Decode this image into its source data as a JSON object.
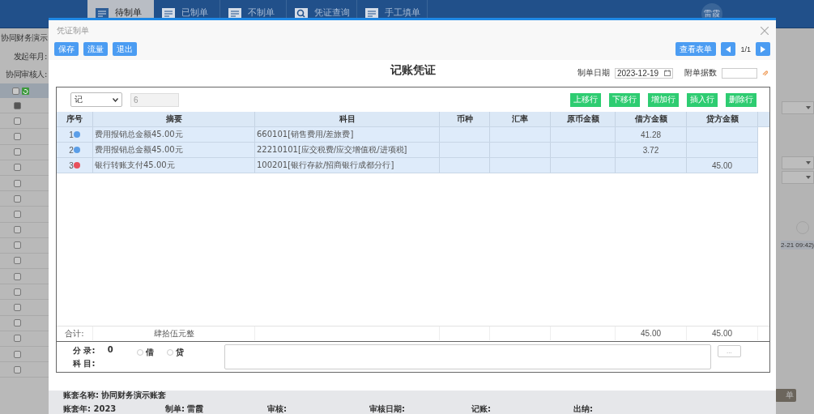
{
  "nav": {
    "tabs": [
      {
        "label": "待制单",
        "selected": true
      },
      {
        "label": "已制单",
        "selected": false
      },
      {
        "label": "不制单",
        "selected": false
      },
      {
        "label": "凭证查询",
        "selected": false
      },
      {
        "label": "手工填单",
        "selected": false
      }
    ],
    "user": "雷霞"
  },
  "left_panel": {
    "account": "协同财务演示",
    "fields": [
      "发起年月:",
      "协同审核人:"
    ],
    "header_checked": false,
    "rows": [
      {
        "checked": true
      },
      {
        "checked": false
      },
      {
        "checked": false
      },
      {
        "checked": false
      },
      {
        "checked": false
      },
      {
        "checked": false
      },
      {
        "checked": false
      },
      {
        "checked": false
      },
      {
        "checked": false
      },
      {
        "checked": false
      },
      {
        "checked": false
      },
      {
        "checked": false
      },
      {
        "checked": false
      },
      {
        "checked": false
      },
      {
        "checked": false
      },
      {
        "checked": false
      },
      {
        "checked": false
      },
      {
        "checked": false
      }
    ]
  },
  "right_panel": {
    "timestamp": "2-21 09:42)",
    "button": "单"
  },
  "dialog": {
    "title": "凭证制单",
    "left_buttons": [
      "保存",
      "流量",
      "退出"
    ],
    "view_button": "查看表单",
    "page": "1/1",
    "voucher_title": "记账凭证",
    "date_label": "制单日期",
    "date": "2023-12-19",
    "attachments_label": "附单据数",
    "voucher_type": "记",
    "voucher_number": "6",
    "row_buttons": [
      "上移行",
      "下移行",
      "增加行",
      "插入行",
      "删除行"
    ],
    "columns": [
      "序号",
      "摘要",
      "科目",
      "币种",
      "汇率",
      "原币金额",
      "借方金额",
      "贷方金额"
    ],
    "rows": [
      {
        "seq": "1",
        "color": "#5b9ee8",
        "summary": "费用报销总金额45.00元",
        "account": "660101[销售费用/差旅费]",
        "debit": "41.28"
      },
      {
        "seq": "2",
        "color": "#5b9ee8",
        "summary": "费用报销总金额45.00元",
        "account": "22210101[应交税费/应交增值税/进项税]",
        "debit": "3.72"
      },
      {
        "seq": "3",
        "color": "#e8505b",
        "summary": "银行转账支付45.00元",
        "account": "100201[银行存款/招商银行成都分行]",
        "credit": "45.00"
      }
    ],
    "total": {
      "label": "合计:",
      "amount_words": "肆拾伍元整",
      "debit": "45.00",
      "credit": "45.00"
    },
    "entry": {
      "count_label": "分 录:",
      "count": "0",
      "account_label": "科 目:",
      "directions": [
        {
          "label": "借",
          "selected": false
        },
        {
          "label": "贷",
          "selected": false
        }
      ],
      "more_button": "..."
    },
    "footer": [
      [
        "账套名称: 协同财务演示账套"
      ],
      [
        "账套年: 2023",
        "制单: 雷霞",
        "审核:",
        "审核日期:",
        "记账:",
        "出纳:"
      ]
    ]
  }
}
